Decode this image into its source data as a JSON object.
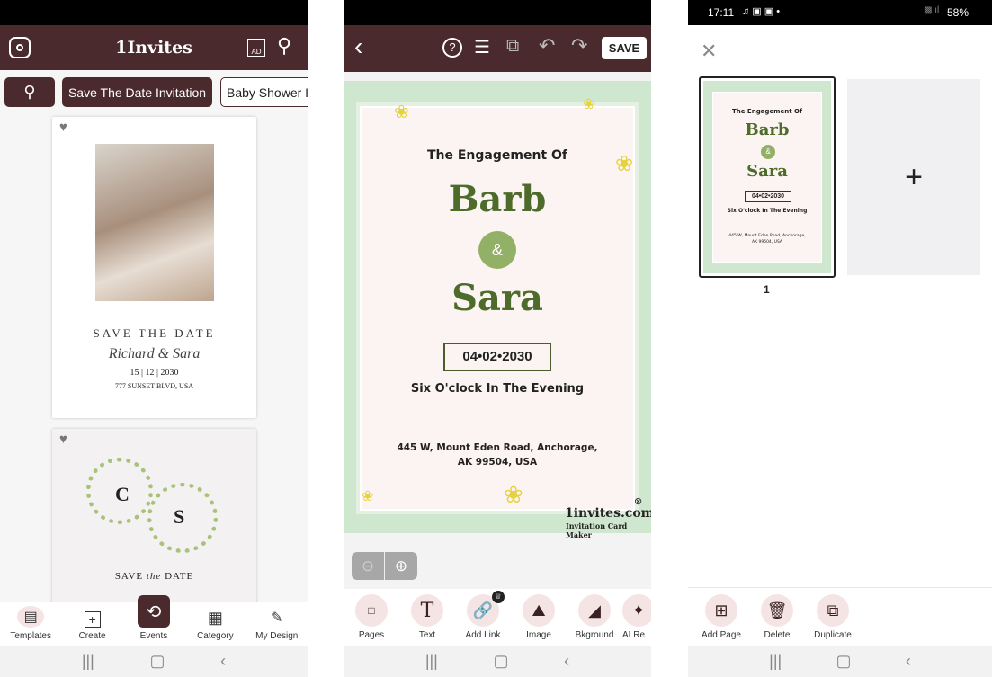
{
  "left": {
    "app_title": "1Invites",
    "chips": [
      "Save The Date Invitation",
      "Baby Shower I"
    ],
    "card1": {
      "title": "SAVE THE DATE",
      "names": "Richard & Sara",
      "date": "15 | 12 | 2030",
      "address": "777 SUNSET BLVD, USA"
    },
    "card2": {
      "initial1": "C",
      "initial2": "S",
      "title_a": "SAVE",
      "title_b": "the",
      "title_c": "DATE"
    },
    "nav": [
      {
        "label": "Templates",
        "icon": "templates-icon"
      },
      {
        "label": "Create",
        "icon": "plus-square-icon"
      },
      {
        "label": "Events",
        "icon": "history-icon"
      },
      {
        "label": "Category",
        "icon": "grid-icon"
      },
      {
        "label": "My Design",
        "icon": "edit-icon"
      }
    ]
  },
  "middle": {
    "save_label": "SAVE",
    "invitation": {
      "heading": "The Engagement Of",
      "name1": "Barb",
      "amp": "&",
      "name2": "Sara",
      "date": "04•02•2030",
      "time": "Six O'clock In The Evening",
      "address1": "445 W, Mount Eden Road, Anchorage,",
      "address2": "AK 99504, USA",
      "watermark": "1invites.com",
      "watermark_sub": "Invitation Card Maker"
    },
    "tools": [
      "Pages",
      "Text",
      "Add Link",
      "Image",
      "Bkground",
      "AI Re"
    ]
  },
  "right": {
    "status_time": "17:11",
    "battery": "58%",
    "page_number": "1",
    "thumb": {
      "heading": "The Engagement Of",
      "name1": "Barb",
      "amp": "&",
      "name2": "Sara",
      "date": "04•02•2030",
      "time": "Six O'clock In The Evening",
      "address1": "445 W, Mount Eden Road, Anchorage,",
      "address2": "AK 99504, USA"
    },
    "tools": [
      "Add Page",
      "Delete",
      "Duplicate"
    ]
  },
  "colors": {
    "brand": "#4a2a2c",
    "green": "#4d6b2a",
    "mint": "#cfe6cf",
    "pink": "#fcf4f2"
  }
}
